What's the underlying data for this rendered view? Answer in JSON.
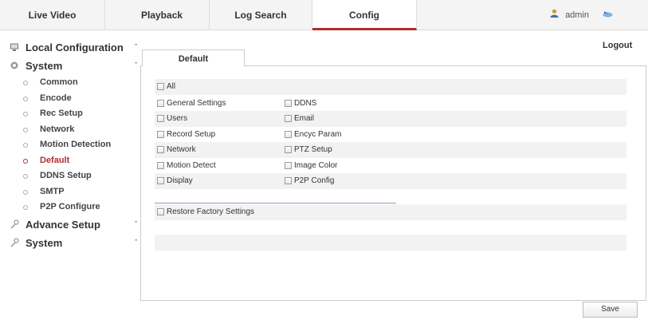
{
  "nav": {
    "tabs": [
      {
        "label": "Live Video"
      },
      {
        "label": "Playback"
      },
      {
        "label": "Log Search"
      },
      {
        "label": "Config"
      }
    ],
    "active_tab": "Config",
    "user": "admin",
    "logout_label": "Logout"
  },
  "sidebar": {
    "local_config": "Local Configuration",
    "system": "System",
    "items": [
      {
        "label": "Common"
      },
      {
        "label": "Encode"
      },
      {
        "label": "Rec Setup"
      },
      {
        "label": "Network"
      },
      {
        "label": "Motion Detection"
      },
      {
        "label": "Default"
      },
      {
        "label": "DDNS Setup"
      },
      {
        "label": "SMTP"
      },
      {
        "label": "P2P Configure"
      }
    ],
    "active_item": "Default",
    "advance_setup": "Advance Setup",
    "system2": "System"
  },
  "content": {
    "tab_label": "Default",
    "all_label": "All",
    "left_options": [
      "General Settings",
      "Users",
      "Record Setup",
      "Network",
      "Motion Detect",
      "Display"
    ],
    "right_options": [
      "DDNS",
      "Email",
      "Encyc Param",
      "PTZ Setup",
      "Image Color",
      "P2P Config"
    ],
    "restore_label": "Restore Factory Settings",
    "save_label": "Save"
  },
  "colors": {
    "accent": "#b22d2d",
    "row_shade": "#f2f2f2"
  },
  "icons": {
    "local_config": "monitor-icon",
    "system": "gear-icon",
    "advance_setup": "wrench-icon",
    "system2": "wrench-icon",
    "user": "user-icon",
    "logout": "logout-icon"
  }
}
